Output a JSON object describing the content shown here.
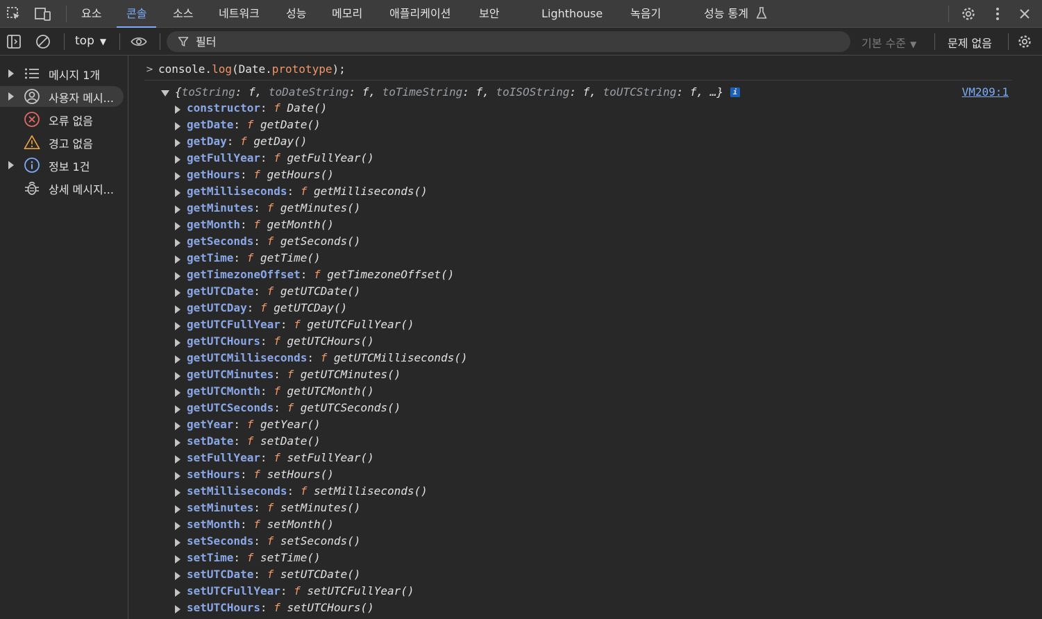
{
  "tabs": [
    {
      "label": "요소",
      "active": false
    },
    {
      "label": "콘솔",
      "active": true
    },
    {
      "label": "소스",
      "active": false
    },
    {
      "label": "네트워크",
      "active": false
    },
    {
      "label": "성능",
      "active": false
    },
    {
      "label": "메모리",
      "active": false
    },
    {
      "label": "애플리케이션",
      "active": false
    },
    {
      "label": "보안",
      "active": false
    },
    {
      "label": "Lighthouse",
      "active": false
    },
    {
      "label": "녹음기",
      "active": false
    },
    {
      "label": "성능 통계",
      "active": false
    }
  ],
  "toolbar": {
    "context": "top",
    "filter_placeholder": "필터",
    "levels": "기본 수준",
    "issues": "문제 없음"
  },
  "sidebar": {
    "items": [
      {
        "label": "메시지 1개",
        "icon": "list-icon",
        "expandable": true,
        "selected": false
      },
      {
        "label": "사용자 메시...",
        "icon": "user-icon",
        "expandable": true,
        "selected": true
      },
      {
        "label": "오류 없음",
        "icon": "error-icon",
        "expandable": false,
        "selected": false
      },
      {
        "label": "경고 없음",
        "icon": "warning-icon",
        "expandable": false,
        "selected": false
      },
      {
        "label": "정보 1건",
        "icon": "info-icon",
        "expandable": true,
        "selected": false
      },
      {
        "label": "상세 메시지...",
        "icon": "bug-icon",
        "expandable": false,
        "selected": false
      }
    ]
  },
  "console": {
    "command": {
      "obj1": "console.",
      "fn1": "log",
      "obj2": "(Date.",
      "fn2": "prototype",
      "end": ");"
    },
    "summary": {
      "open": "{",
      "k1": "toString",
      "k2": "toDateString",
      "k3": "toTimeString",
      "k4": "toISOString",
      "k5": "toUTCString",
      "fsym": "f",
      "tail": "…}"
    },
    "source_link": "VM209:1",
    "properties": [
      {
        "name": "constructor",
        "value": "Date()"
      },
      {
        "name": "getDate",
        "value": "getDate()"
      },
      {
        "name": "getDay",
        "value": "getDay()"
      },
      {
        "name": "getFullYear",
        "value": "getFullYear()"
      },
      {
        "name": "getHours",
        "value": "getHours()"
      },
      {
        "name": "getMilliseconds",
        "value": "getMilliseconds()"
      },
      {
        "name": "getMinutes",
        "value": "getMinutes()"
      },
      {
        "name": "getMonth",
        "value": "getMonth()"
      },
      {
        "name": "getSeconds",
        "value": "getSeconds()"
      },
      {
        "name": "getTime",
        "value": "getTime()"
      },
      {
        "name": "getTimezoneOffset",
        "value": "getTimezoneOffset()"
      },
      {
        "name": "getUTCDate",
        "value": "getUTCDate()"
      },
      {
        "name": "getUTCDay",
        "value": "getUTCDay()"
      },
      {
        "name": "getUTCFullYear",
        "value": "getUTCFullYear()"
      },
      {
        "name": "getUTCHours",
        "value": "getUTCHours()"
      },
      {
        "name": "getUTCMilliseconds",
        "value": "getUTCMilliseconds()"
      },
      {
        "name": "getUTCMinutes",
        "value": "getUTCMinutes()"
      },
      {
        "name": "getUTCMonth",
        "value": "getUTCMonth()"
      },
      {
        "name": "getUTCSeconds",
        "value": "getUTCSeconds()"
      },
      {
        "name": "getYear",
        "value": "getYear()"
      },
      {
        "name": "setDate",
        "value": "setDate()"
      },
      {
        "name": "setFullYear",
        "value": "setFullYear()"
      },
      {
        "name": "setHours",
        "value": "setHours()"
      },
      {
        "name": "setMilliseconds",
        "value": "setMilliseconds()"
      },
      {
        "name": "setMinutes",
        "value": "setMinutes()"
      },
      {
        "name": "setMonth",
        "value": "setMonth()"
      },
      {
        "name": "setSeconds",
        "value": "setSeconds()"
      },
      {
        "name": "setTime",
        "value": "setTime()"
      },
      {
        "name": "setUTCDate",
        "value": "setUTCDate()"
      },
      {
        "name": "setUTCFullYear",
        "value": "setUTCFullYear()"
      },
      {
        "name": "setUTCHours",
        "value": "setUTCHours()"
      }
    ]
  },
  "colors": {
    "accent": "#7cacf8",
    "function": "#f29766",
    "property": "#8aa8e8",
    "background": "#282828"
  }
}
